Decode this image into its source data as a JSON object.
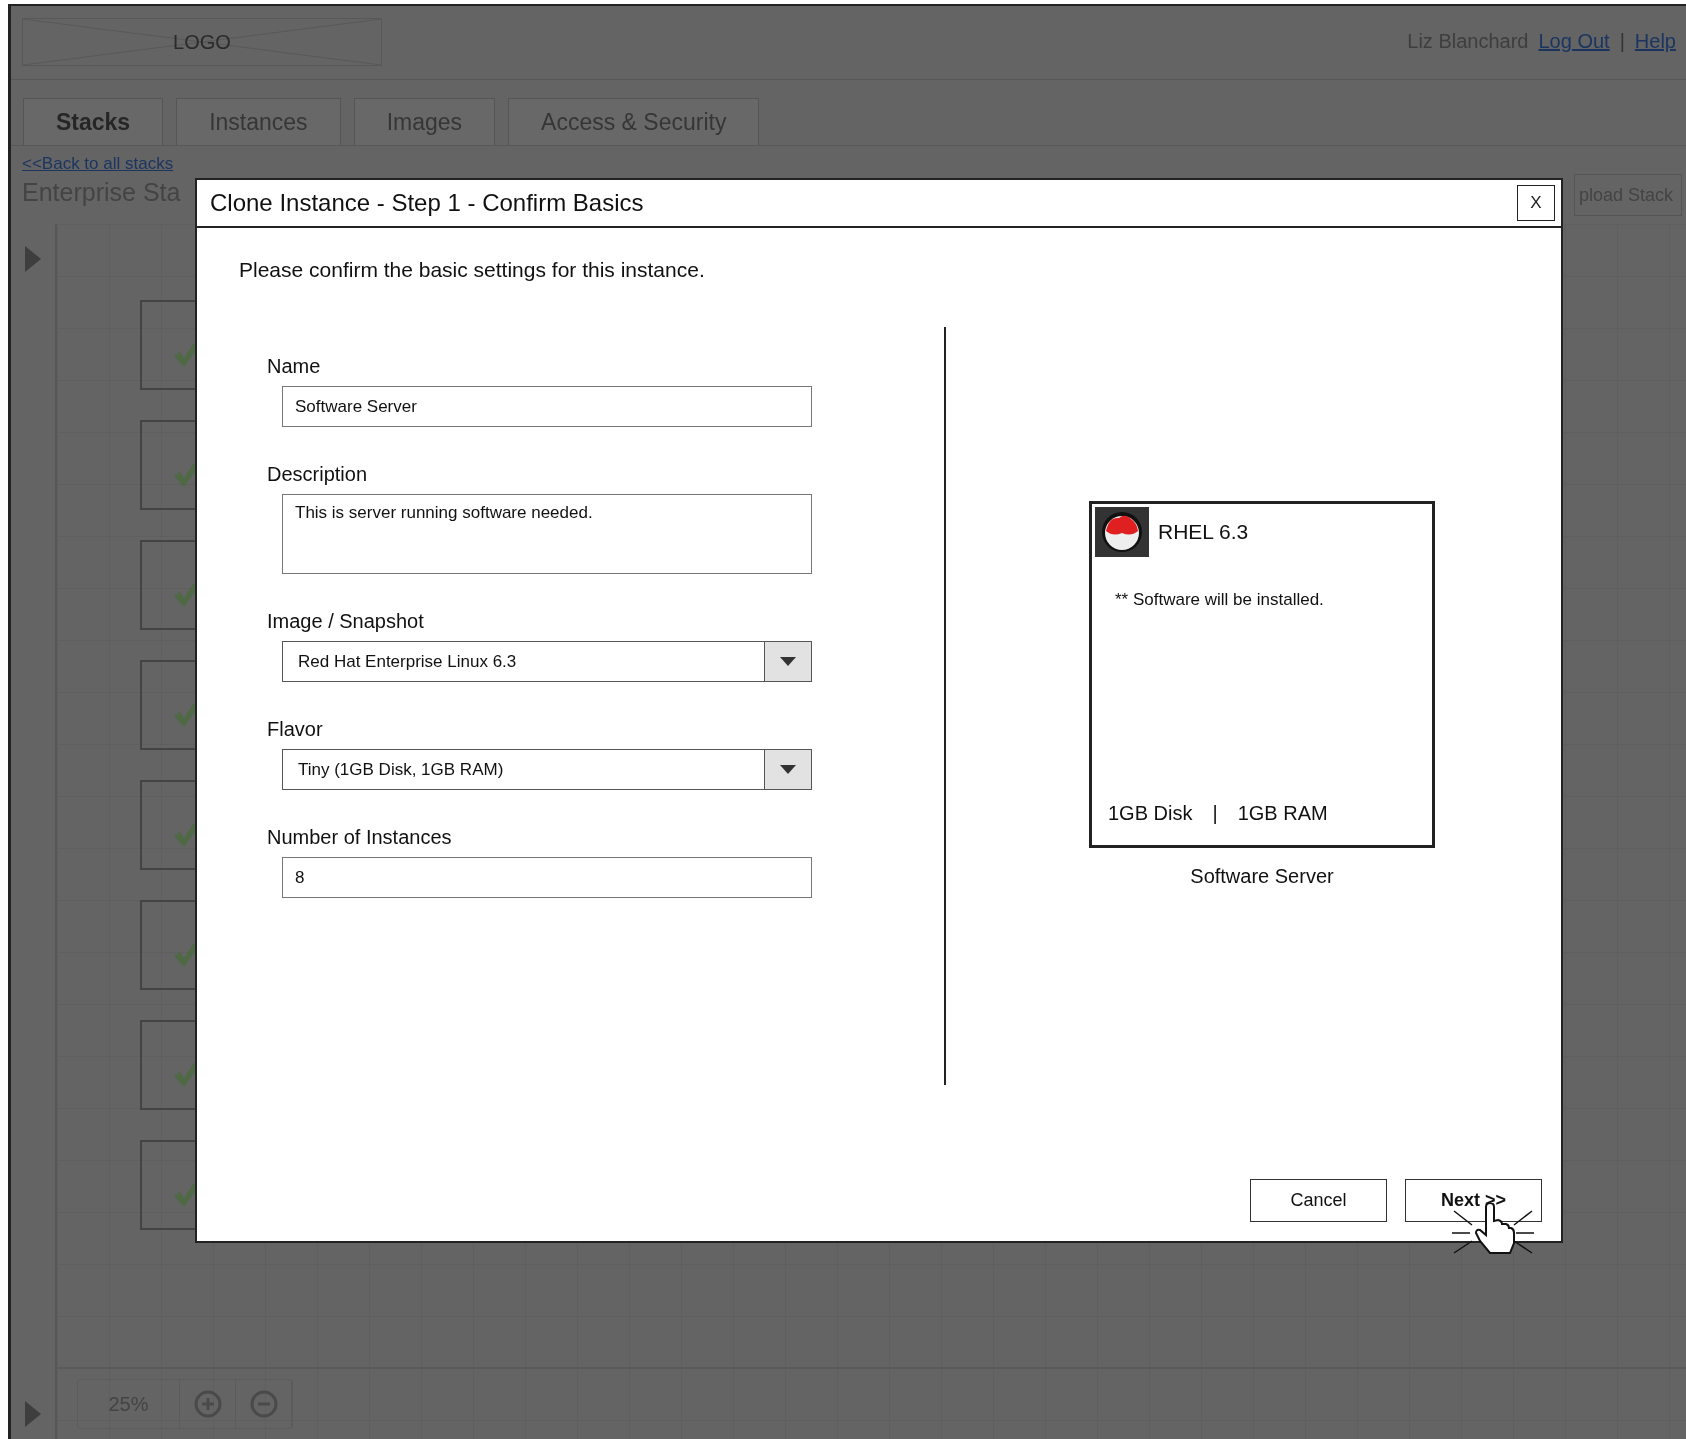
{
  "header": {
    "logo": "LOGO",
    "user": "Liz Blanchard",
    "links": [
      {
        "label": "Log Out"
      },
      {
        "label": "Help"
      }
    ],
    "separator": "|"
  },
  "tabs": [
    {
      "label": "Stacks",
      "selected": true
    },
    {
      "label": "Instances",
      "selected": false
    },
    {
      "label": "Images",
      "selected": false
    },
    {
      "label": "Access & Security",
      "selected": false
    }
  ],
  "breadcrumb": "<<Back to all stacks",
  "page_title": "Enterprise Sta",
  "toolbar_button": "pload Stack",
  "canvas": {
    "tiles": [
      {
        "checked": true
      },
      {
        "checked": true
      },
      {
        "checked": true
      },
      {
        "checked": true
      },
      {
        "checked": true
      },
      {
        "checked": true
      },
      {
        "checked": true
      },
      {
        "checked": true
      }
    ],
    "zoom": "25%"
  },
  "dialog": {
    "title": "Clone Instance - Step 1 - Confirm Basics",
    "close": "X",
    "instruction": "Please confirm the basic settings for this instance.",
    "fields": [
      {
        "kind": "text",
        "label": "Name",
        "value": "Software Server"
      },
      {
        "kind": "textarea",
        "label": "Description",
        "value": "This is server running software needed."
      },
      {
        "kind": "select",
        "label": "Image / Snapshot",
        "value": "Red Hat Enterprise Linux 6.3"
      },
      {
        "kind": "select",
        "label": "Flavor",
        "value": "Tiny (1GB Disk, 1GB RAM)"
      },
      {
        "kind": "text",
        "label": "Number of Instances",
        "value": "8"
      }
    ],
    "preview": {
      "title": "RHEL 6.3",
      "note": "** Software will be installed.",
      "disk": "1GB Disk",
      "separator": "|",
      "ram": "1GB RAM",
      "caption": "Software Server"
    },
    "buttons": [
      {
        "label": "Cancel",
        "kind": "secondary"
      },
      {
        "label": "Next >>",
        "kind": "primary"
      }
    ]
  }
}
